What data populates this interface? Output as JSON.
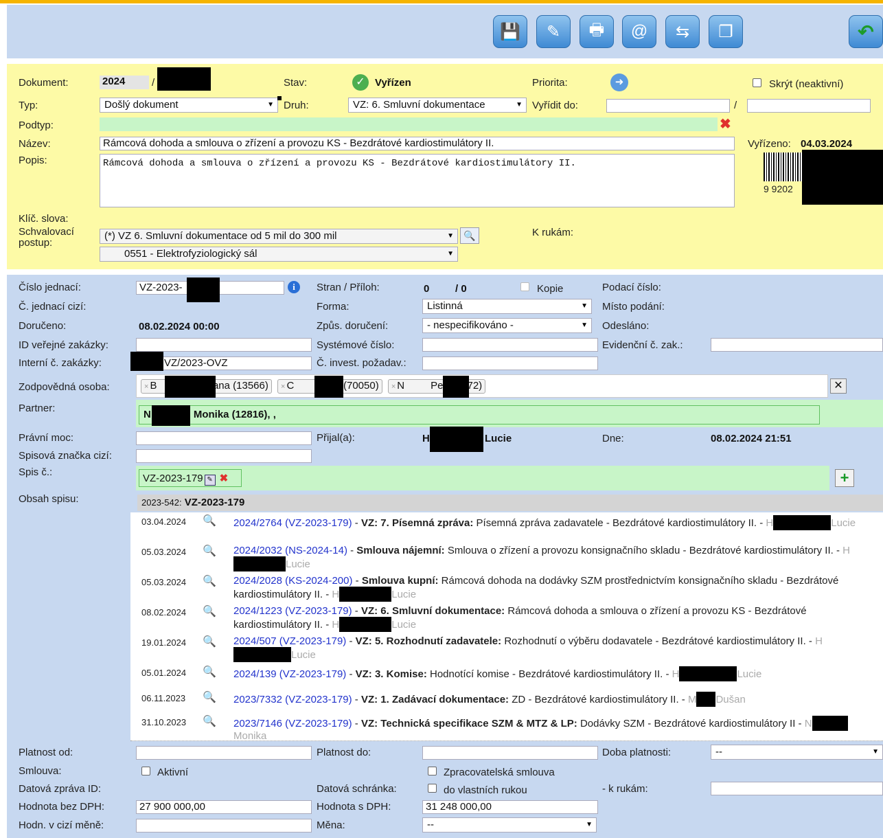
{
  "toolbar": {
    "buttons": [
      {
        "name": "save-icon",
        "glyph": "💾"
      },
      {
        "name": "edit-icon",
        "glyph": "✎"
      },
      {
        "name": "print-icon",
        "glyph": "🖶"
      },
      {
        "name": "email-icon",
        "glyph": "@"
      },
      {
        "name": "refresh-icon",
        "glyph": "⇆"
      },
      {
        "name": "copy-icon",
        "glyph": "❐"
      }
    ],
    "back_glyph": "↶"
  },
  "header": {
    "dokument_label": "Dokument:",
    "dokument_year": "2024",
    "dokument_sep": "/",
    "stav_label": "Stav:",
    "stav_value": "Vyřízen",
    "priorita_label": "Priorita:",
    "skryt_label": "Skrýt (neaktivní)",
    "typ_label": "Typ:",
    "typ_value": "Došlý dokument",
    "druh_label": "Druh:",
    "druh_value": "VZ: 6. Smluvní dokumentace",
    "vyridit_label": "Vyřídit do:",
    "vyridit_sep": "/",
    "podtyp_label": "Podtyp:",
    "nazev_label": "Název:",
    "nazev_value": "Rámcová dohoda a smlouva o zřízení a provozu KS - Bezdrátové kardiostimulátory II.",
    "vyrizeno_label": "Vyřízeno:",
    "vyrizeno_value": "04.03.2024",
    "popis_label": "Popis:",
    "popis_value": "Rámcová dohoda a smlouva o zřízení a provozu KS - Bezdrátové kardiostimulátory II.",
    "barcode_text": "9  9202",
    "klic_label": "Klíč. slova:",
    "schval_label1": "Schvalovací",
    "schval_label2": "postup:",
    "schval_value": "(*) VZ 6. Smluvní dokumentace od 5 mil do 300 mil",
    "schval_value2": "0551 - Elektrofyziologický sál",
    "krukam_label": "K rukám:"
  },
  "form": {
    "cj_label": "Číslo jednací:",
    "cj_value": "VZ-2023-",
    "stran_label": "Stran / Příloh:",
    "stran_value": "0",
    "prilohy_value": "/ 0",
    "kopie_label": "Kopie",
    "podaci_label": "Podací číslo:",
    "cj_cizi_label": "Č. jednací cizí:",
    "forma_label": "Forma:",
    "forma_value": "Listinná",
    "misto_label": "Místo podání:",
    "doruceno_label": "Doručeno:",
    "doruceno_value": "08.02.2024 00:00",
    "zpus_label": "Způs. doručení:",
    "zpus_value": "- nespecifikováno -",
    "odeslano_label": "Odesláno:",
    "id_vz_label": "ID veřejné zakázky:",
    "sys_label": "Systémové číslo:",
    "evid_label": "Evidenční č. zak.:",
    "int_label": "Interní č. zakázky:",
    "int_value": "VZ/2023-OVZ",
    "invest_label": "Č. invest. požadav.:",
    "zodp_label": "Zodpovědná osoba:",
    "zodp_tags": [
      {
        "a": "B",
        "b": "Jana (13566)"
      },
      {
        "a": "C",
        "b": "Filip (70050)"
      },
      {
        "a": "N",
        "b": "Petr (2872)"
      }
    ],
    "partner_label": "Partner:",
    "partner_a": "N",
    "partner_b": "Monika (12816), ,",
    "pravni_label": "Právní moc:",
    "prijal_label": "Přijal(a):",
    "prijal_a": "H",
    "prijal_b": "Lucie",
    "dne_label": "Dne:",
    "dne_value": "08.02.2024 21:51",
    "spisova_label": "Spisová značka cizí:",
    "spis_label": "Spis č.:",
    "spis_value": "VZ-2023-179",
    "obsah_label": "Obsah spisu:",
    "obsah_head_a": "2023-542:",
    "obsah_head_b": "VZ-2023-179"
  },
  "spis_rows": [
    {
      "date": "03.04.2024",
      "link": "2024/2764 (VZ-2023-179)",
      "type": "VZ: 7. Písemná zpráva:",
      "desc": "Písemná zpráva zadavatele - Bezdrátové kardiostimulátory II. -",
      "who_a": "H",
      "who_b": "Lucie"
    },
    {
      "date": "05.03.2024",
      "link": "2024/2032 (NS-2024-14)",
      "type": "Smlouva nájemní:",
      "desc": "Smlouva o zřízení a provozu konsignačního skladu - Bezdrátové kardiostimulátory II. -",
      "who_a": "H",
      "who_b": "Lucie"
    },
    {
      "date": "05.03.2024",
      "link": "2024/2028 (KS-2024-200)",
      "type": "Smlouva kupní:",
      "desc": "Rámcová dohoda na dodávky SZM prostřednictvím konsignačního skladu - Bezdrátové kardiostimulátory II. -",
      "who_a": "H",
      "who_b": "Lucie"
    },
    {
      "date": "08.02.2024",
      "link": "2024/1223 (VZ-2023-179)",
      "type": "VZ: 6. Smluvní dokumentace:",
      "desc": "Rámcová dohoda a smlouva o zřízení a provozu KS - Bezdrátové kardiostimulátory II. -",
      "who_a": "H",
      "who_b": "Lucie"
    },
    {
      "date": "19.01.2024",
      "link": "2024/507 (VZ-2023-179)",
      "type": "VZ: 5. Rozhodnutí zadavatele:",
      "desc": "Rozhodnutí o výběru dodavatele - Bezdrátové kardiostimulátory II. -",
      "who_a": "H",
      "who_b": "Lucie"
    },
    {
      "date": "05.01.2024",
      "link": "2024/139 (VZ-2023-179)",
      "type": "VZ: 3. Komise:",
      "desc": "Hodnotící komise - Bezdrátové kardiostimulátory II. -",
      "who_a": "H",
      "who_b": "Lucie"
    },
    {
      "date": "06.11.2023",
      "link": "2023/7332 (VZ-2023-179)",
      "type": "VZ: 1. Zadávací dokumentace:",
      "desc": "ZD - Bezdrátové kardiostimulátory II. -",
      "who_a": "M",
      "who_b": "Dušan"
    },
    {
      "date": "31.10.2023",
      "link": "2023/7146 (VZ-2023-179)",
      "type": "VZ: Technická specifikace SZM & MTZ & LP:",
      "desc": "Dodávky SZM - Bezdrátové kardiostimulátory II -",
      "who_a": "N",
      "who_b": "Monika"
    }
  ],
  "bottom": {
    "platnost_od_label": "Platnost od:",
    "platnost_do_label": "Platnost do:",
    "doba_label": "Doba platnosti:",
    "doba_value": "--",
    "smlouva_label": "Smlouva:",
    "aktivni_label": "Aktivní",
    "zprac_label": "Zpracovatelská smlouva",
    "dzid_label": "Datová zpráva ID:",
    "ds_label": "Datová schránka:",
    "vlastni_label": "do vlastních rukou",
    "krukam_label": "- k rukám:",
    "hbd_label": "Hodnota bez DPH:",
    "hbd_value": "27 900 000,00",
    "hsd_label": "Hodnota s DPH:",
    "hsd_value": "31 248 000,00",
    "hcm_label": "Hodn. v cizí měně:",
    "mena_label": "Měna:",
    "mena_value": "--"
  }
}
